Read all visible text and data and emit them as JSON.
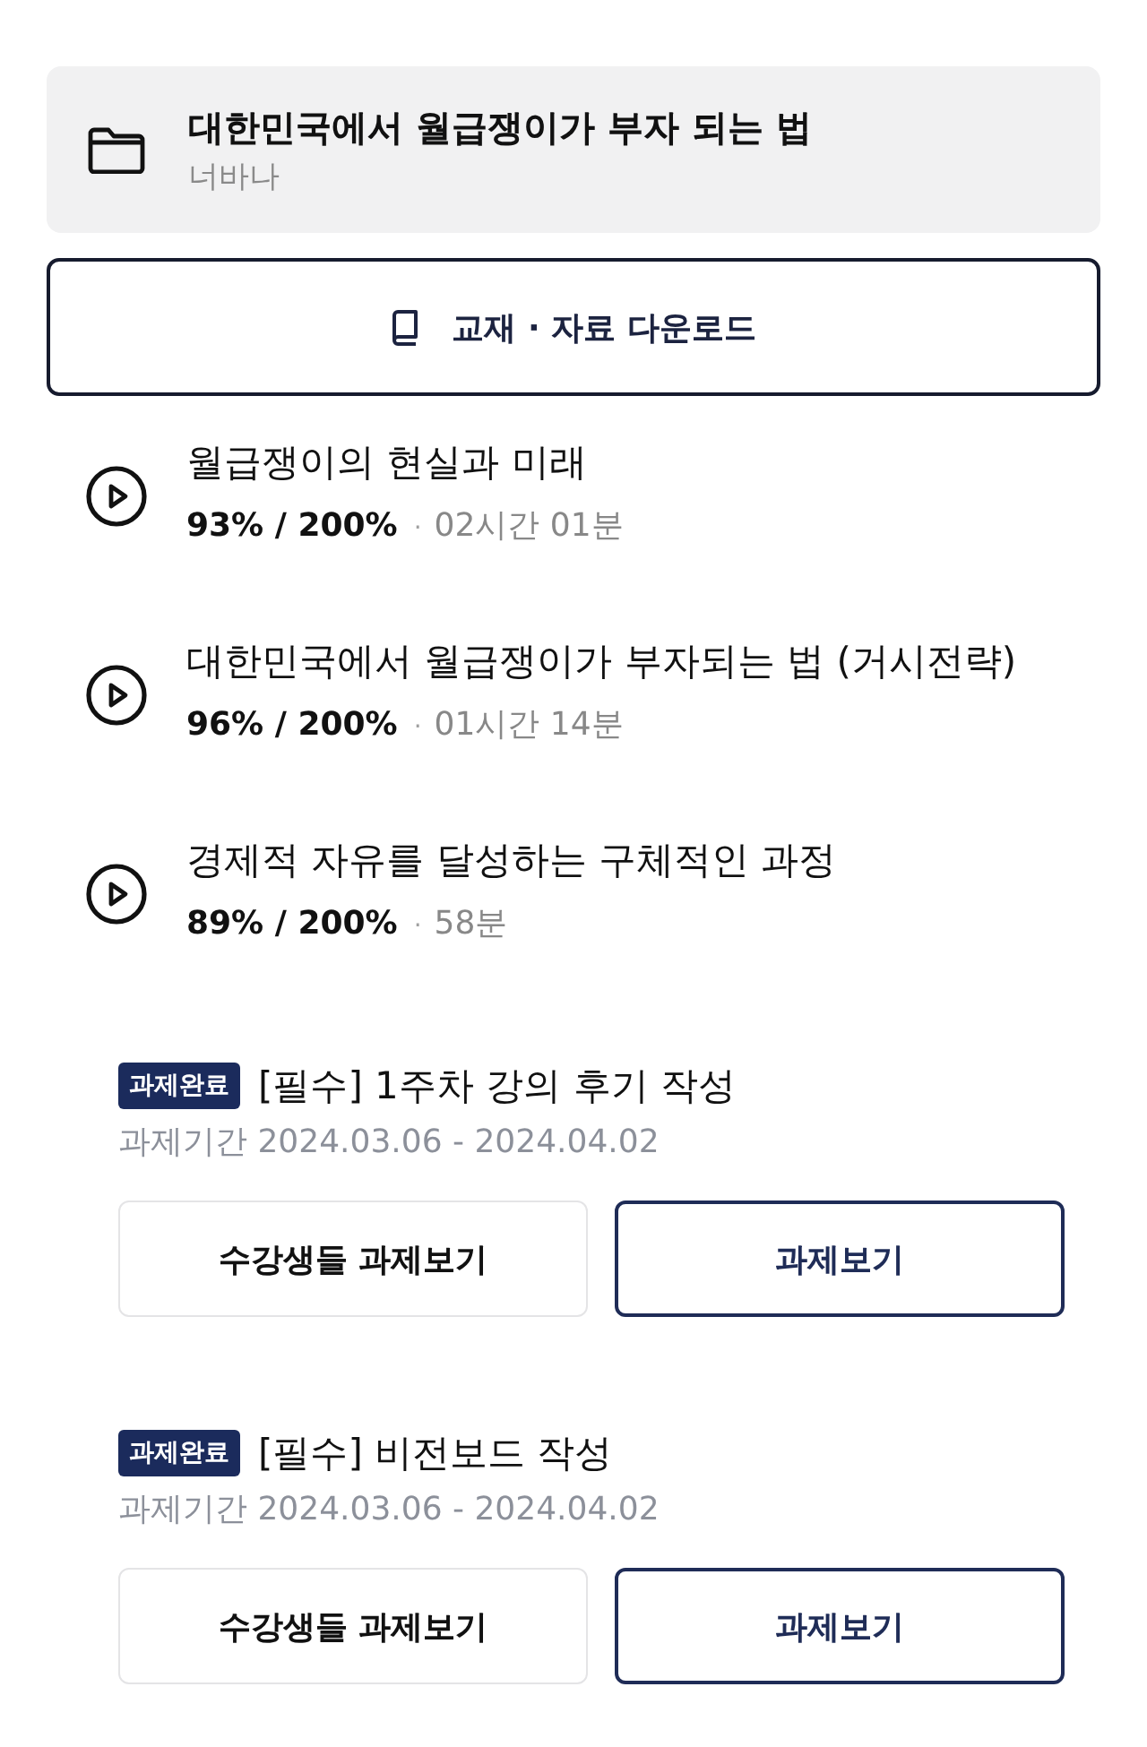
{
  "course": {
    "title": "대한민국에서 월급쟁이가 부자 되는 법",
    "author": "너바나"
  },
  "download_button": {
    "label": "교재 · 자료 다운로드"
  },
  "lessons": [
    {
      "title": "월급쟁이의 현실과 미래",
      "progress": "93% / 200%",
      "separator": "·",
      "duration": "02시간 01분"
    },
    {
      "title": "대한민국에서 월급쟁이가 부자되는 법 (거시전략)",
      "progress": "96% / 200%",
      "separator": "·",
      "duration": "01시간 14분"
    },
    {
      "title": "경제적 자유를 달성하는 구체적인 과정",
      "progress": "89% / 200%",
      "separator": "·",
      "duration": "58분"
    }
  ],
  "assignments": [
    {
      "status": "과제완료",
      "title": "[필수] 1주차 강의 후기 작성",
      "period": "과제기간 2024.03.06 - 2024.04.02",
      "buttons": [
        {
          "label": "수강생들 과제보기",
          "kind": "secondary"
        },
        {
          "label": "과제보기",
          "kind": "primary"
        }
      ]
    },
    {
      "status": "과제완료",
      "title": "[필수] 비전보드 작성",
      "period": "과제기간 2024.03.06 - 2024.04.02",
      "buttons": [
        {
          "label": "수강생들 과제보기",
          "kind": "secondary"
        },
        {
          "label": "과제보기",
          "kind": "primary"
        }
      ]
    }
  ]
}
